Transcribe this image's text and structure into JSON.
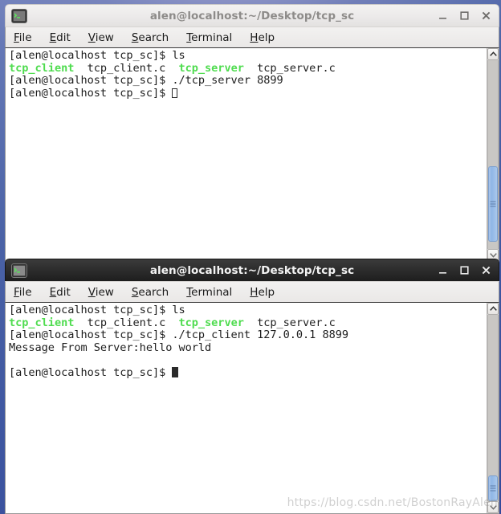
{
  "desktop": {
    "background_color": "#4a62a6"
  },
  "windows": [
    {
      "id": "terminal-server",
      "title": "alen@localhost:~/Desktop/tcp_sc",
      "focused": false,
      "icon": "terminal-icon",
      "menu": [
        {
          "mnemonic": "F",
          "rest": "ile"
        },
        {
          "mnemonic": "E",
          "rest": "dit"
        },
        {
          "mnemonic": "V",
          "rest": "iew"
        },
        {
          "mnemonic": "S",
          "rest": "earch"
        },
        {
          "mnemonic": "T",
          "rest": "erminal"
        },
        {
          "mnemonic": "H",
          "rest": "elp"
        }
      ],
      "controls": {
        "minimize": "minimize-icon",
        "maximize": "maximize-icon",
        "close": "close-icon"
      },
      "terminal": {
        "lines": [
          {
            "segments": [
              {
                "text": "[alen@localhost tcp_sc]$ ls",
                "color": "normal"
              }
            ]
          },
          {
            "segments": [
              {
                "text": "tcp_client",
                "color": "green"
              },
              {
                "text": "  tcp_client.c  ",
                "color": "normal"
              },
              {
                "text": "tcp_server",
                "color": "green"
              },
              {
                "text": "  tcp_server.c",
                "color": "normal"
              }
            ]
          },
          {
            "segments": [
              {
                "text": "[alen@localhost tcp_sc]$ ./tcp_server 8899",
                "color": "normal"
              }
            ]
          },
          {
            "segments": [
              {
                "text": "[alen@localhost tcp_sc]$ ",
                "color": "normal"
              }
            ],
            "cursor": "hollow"
          }
        ]
      },
      "scrollbar": {
        "up_arrow": "scroll-up-icon",
        "down_arrow": "scroll-down-icon",
        "thumb_top_percent": 56,
        "thumb_height_percent": 40
      }
    },
    {
      "id": "terminal-client",
      "title": "alen@localhost:~/Desktop/tcp_sc",
      "focused": true,
      "icon": "terminal-icon",
      "menu": [
        {
          "mnemonic": "F",
          "rest": "ile"
        },
        {
          "mnemonic": "E",
          "rest": "dit"
        },
        {
          "mnemonic": "V",
          "rest": "iew"
        },
        {
          "mnemonic": "S",
          "rest": "earch"
        },
        {
          "mnemonic": "T",
          "rest": "erminal"
        },
        {
          "mnemonic": "H",
          "rest": "elp"
        }
      ],
      "controls": {
        "minimize": "minimize-icon",
        "maximize": "maximize-icon",
        "close": "close-icon"
      },
      "terminal": {
        "lines": [
          {
            "segments": [
              {
                "text": "[alen@localhost tcp_sc]$ ls",
                "color": "normal"
              }
            ]
          },
          {
            "segments": [
              {
                "text": "tcp_client",
                "color": "green"
              },
              {
                "text": "  tcp_client.c  ",
                "color": "normal"
              },
              {
                "text": "tcp_server",
                "color": "green"
              },
              {
                "text": "  tcp_server.c",
                "color": "normal"
              }
            ]
          },
          {
            "segments": [
              {
                "text": "[alen@localhost tcp_sc]$ ./tcp_client 127.0.0.1 8899",
                "color": "normal"
              }
            ]
          },
          {
            "segments": [
              {
                "text": "Message From Server:hello world",
                "color": "normal"
              }
            ]
          },
          {
            "segments": [
              {
                "text": "",
                "color": "normal"
              }
            ]
          },
          {
            "segments": [
              {
                "text": "[alen@localhost tcp_sc]$ ",
                "color": "normal"
              }
            ],
            "cursor": "solid"
          }
        ]
      },
      "scrollbar": {
        "up_arrow": "scroll-up-icon",
        "down_arrow": "scroll-down-icon",
        "thumb_top_percent": 86,
        "thumb_height_percent": 14
      }
    }
  ],
  "watermark": {
    "text": "https://blog.csdn.net/BostonRayAlen"
  }
}
